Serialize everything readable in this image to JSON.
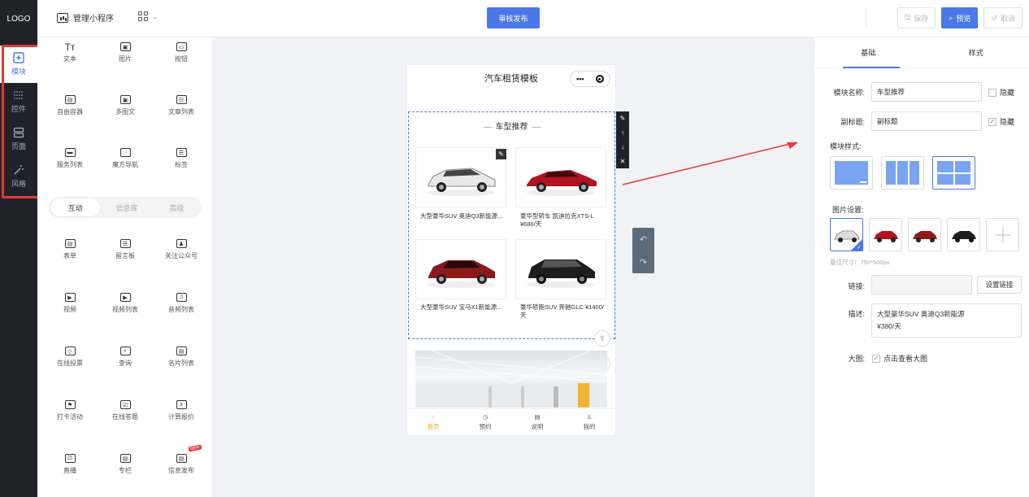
{
  "header": {
    "logo": "LOGO",
    "app_name": "管理小程序",
    "publish": "审核发布",
    "save": "保存",
    "preview": "预览",
    "cancel": "取消"
  },
  "darknav": [
    {
      "label": "模块",
      "icon": "plus-square-icon"
    },
    {
      "label": "控件",
      "icon": "sliders-icon"
    },
    {
      "label": "页面",
      "icon": "pages-icon"
    },
    {
      "label": "风格",
      "icon": "magic-wand-icon"
    }
  ],
  "components": {
    "basic": [
      "文本",
      "图片",
      "按钮",
      "自由容器",
      "多图文",
      "文章列表",
      "服务列表",
      "魔方导航",
      "标签"
    ],
    "tabs": [
      "互动",
      "信息库",
      "高级"
    ],
    "interactive": [
      "表单",
      "留言板",
      "关注公众号",
      "视频",
      "视频列表",
      "音频列表",
      "在线投票",
      "查询",
      "名片列表",
      "打卡活动",
      "在线答题",
      "计算报价",
      "直播",
      "专栏",
      "信息发布"
    ],
    "new_badge": "NEW"
  },
  "phone": {
    "title": "汽车租赁模板",
    "capsule_dots": "•••",
    "module_title": "车型推荐",
    "cars": [
      {
        "caption": "大型豪华SUV 奥迪Q3新能源...",
        "color": "#e8e8e8"
      },
      {
        "caption": "豪华型轿车 凯迪拉克XTS-L ¥686/天",
        "color": "#b3121f"
      },
      {
        "caption": "大型豪华SUV 宝马X1新能源...",
        "color": "#8c1a1a"
      },
      {
        "caption": "豪华轿跑SUV 奔驰GLC ¥1400/天",
        "color": "#1e1e1e"
      }
    ],
    "tabbar": [
      "首页",
      "预约",
      "说明",
      "我的"
    ]
  },
  "panel": {
    "tabs": [
      "基础",
      "样式"
    ],
    "name_label": "模块名称:",
    "name_value": "车型推荐",
    "hide_label": "隐藏",
    "subtitle_label": "副标题:",
    "subtitle_value": "副标题",
    "style_label": "模块样式:",
    "image_label": "图片设置:",
    "hint": "最佳尺寸：750*500px",
    "link_label": "链接:",
    "link_button": "设置链接",
    "desc_label": "描述:",
    "desc_line1": "大型豪华SUV 奥迪Q3新能源",
    "desc_line2": "¥380/天",
    "big_label": "大图:",
    "big_check": "点击查看大图"
  },
  "colors": {
    "accent": "#4a78e8",
    "dark": "#1f2329",
    "highlight": "#e53935",
    "tab_active": "#f5a623"
  }
}
